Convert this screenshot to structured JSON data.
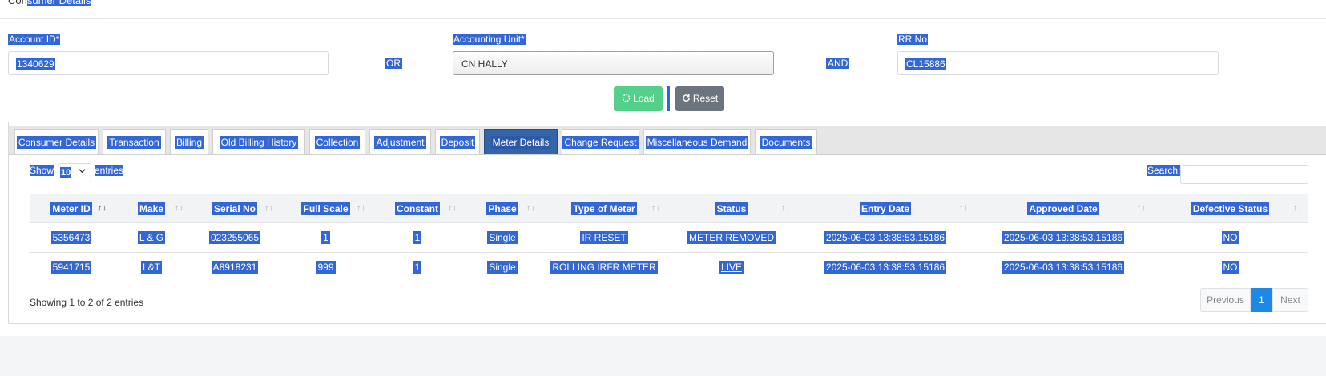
{
  "header": {
    "title_prefix": "Con",
    "title_rest": "sumer Details"
  },
  "form": {
    "account_label": "Account ID*",
    "account_value": "1340629",
    "or_label": "OR",
    "unit_label": "Accounting Unit*",
    "unit_value": "CN HALLY",
    "and_label": "AND",
    "rr_label": "RR No",
    "rr_value": "CL15886",
    "load_label": "Load",
    "reset_label": "Reset"
  },
  "tabs": [
    "Consumer Details",
    "Transaction",
    "Billing",
    "Old Billing History",
    "Collection",
    "Adjustment",
    "Deposit",
    "Meter Details",
    "Change Request",
    "Miscellaneous Demand",
    "Documents"
  ],
  "active_tab": "Meter Details",
  "table_controls": {
    "show": "Show",
    "page_size": "10",
    "entries": "entries",
    "search": "Search:"
  },
  "columns": [
    "Meter ID",
    "Make",
    "Serial No",
    "Full Scale",
    "Constant",
    "Phase",
    "Type of Meter",
    "Status",
    "Entry Date",
    "Approved Date",
    "Defective Status"
  ],
  "rows": [
    [
      "5356473",
      "L & G",
      "023255065",
      "1",
      "1",
      "Single",
      "IR RESET",
      "METER REMOVED",
      "2025-06-03 13:38:53.15186",
      "2025-06-03 13:38:53.15186",
      "NO"
    ],
    [
      "5941715",
      "L&T",
      "A8918231",
      "999",
      "1",
      "Single",
      "ROLLING IRFR METER",
      "LIVE",
      "2025-06-03 13:38:53.15186",
      "2025-06-03 13:38:53.15186",
      "NO"
    ]
  ],
  "info": "Showing 1 to 2 of 2 entries",
  "pagination": {
    "previous": "Previous",
    "current": "1",
    "next": "Next"
  },
  "colors": {
    "selection": "#3367d6",
    "load": "#55d08a",
    "reset": "#6c757d",
    "active_tab": "#3366a8",
    "page_active": "#1e88e5"
  }
}
